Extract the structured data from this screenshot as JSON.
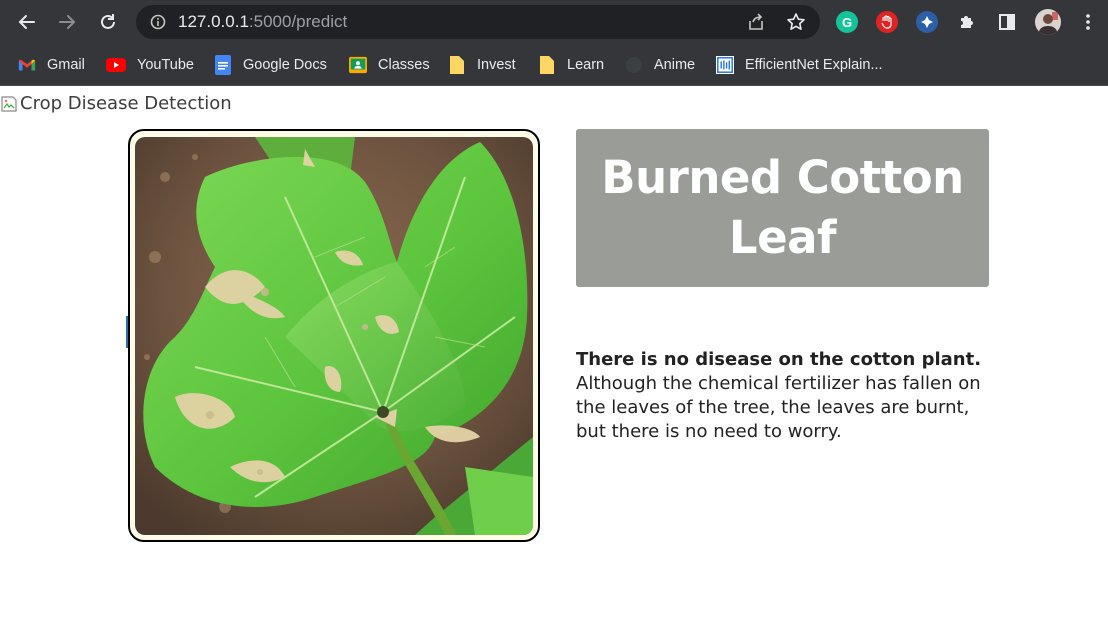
{
  "browser": {
    "url_host": "127.0.0.1",
    "url_path": ":5000/predict",
    "bookmarks": [
      {
        "label": "Gmail",
        "icon": "gmail-icon"
      },
      {
        "label": "YouTube",
        "icon": "youtube-icon"
      },
      {
        "label": "Google Docs",
        "icon": "docs-icon"
      },
      {
        "label": "Classes",
        "icon": "classroom-icon"
      },
      {
        "label": "Invest",
        "icon": "folder-icon"
      },
      {
        "label": "Learn",
        "icon": "folder-icon"
      },
      {
        "label": "Anime",
        "icon": "globe-icon"
      },
      {
        "label": "EfficientNet Explain...",
        "icon": "site-icon"
      }
    ],
    "extensions": [
      "grammarly-icon",
      "block-icon",
      "compass-icon",
      "puzzle-icon",
      "sidepanel-icon",
      "avatar"
    ]
  },
  "page": {
    "header_image_alt": "Crop Disease Detection",
    "result_title": "Burned Cotton Leaf",
    "description_bold": "There is no disease on the cotton plant.",
    "description_text": "Although the chemical fertilizer has fallen on the leaves of the tree, the leaves are burnt, but there is no need to worry."
  },
  "colors": {
    "chrome": "#35363a",
    "omnibox": "#202124",
    "result_box": "#9a9c97",
    "frame_border": "#000000"
  }
}
